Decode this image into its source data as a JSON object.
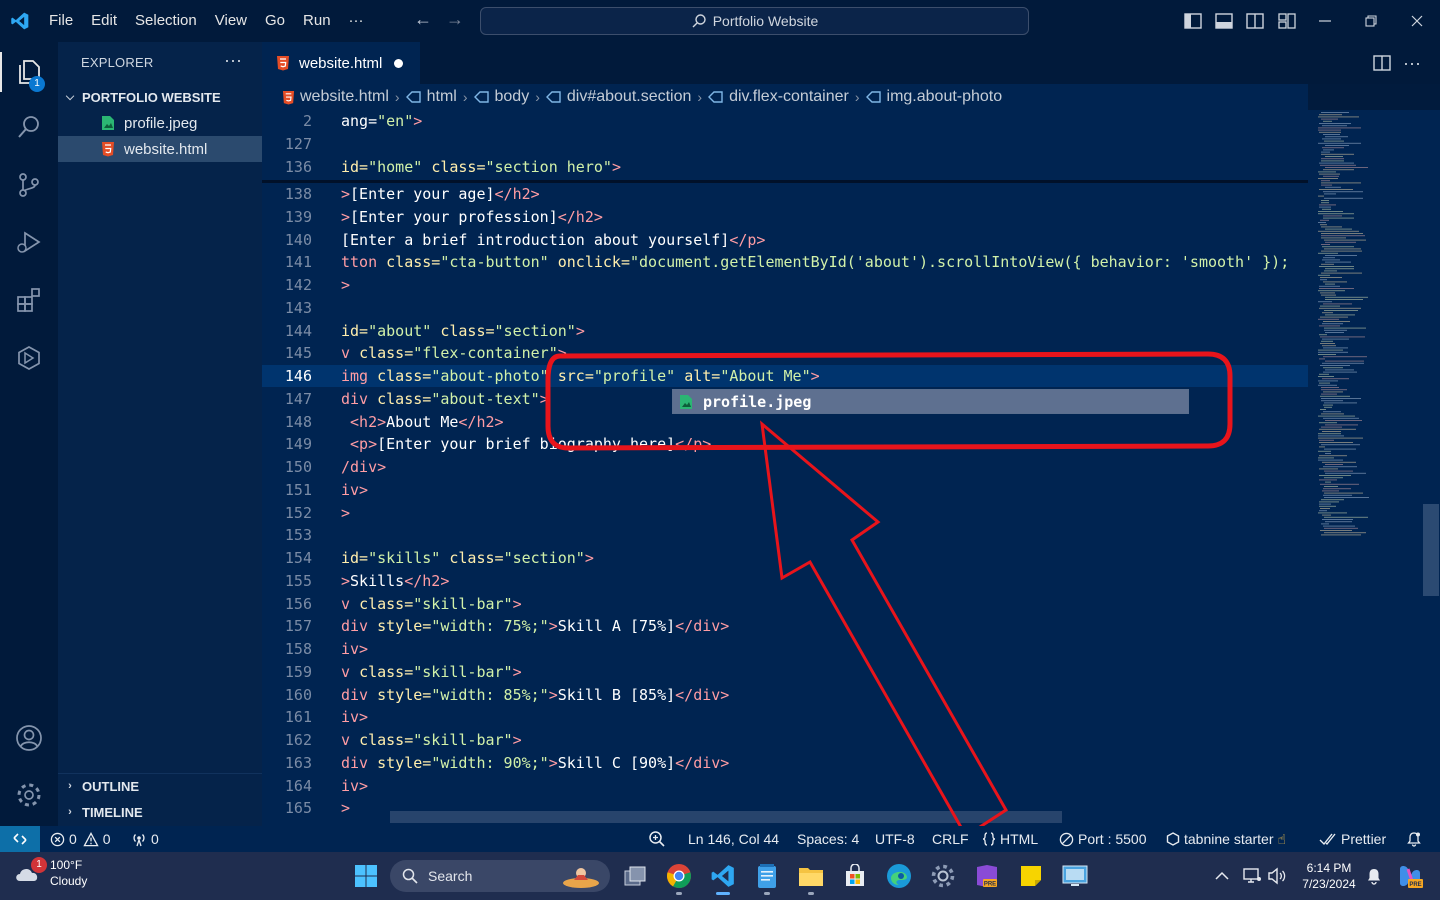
{
  "titlebar": {
    "menu": [
      "File",
      "Edit",
      "Selection",
      "View",
      "Go",
      "Run",
      "···"
    ],
    "search_text": "Portfolio Website"
  },
  "activity": {
    "explorer_badge": "1"
  },
  "sidebar": {
    "title": "EXPLORER",
    "more": "···",
    "folder": "PORTFOLIO WEBSITE",
    "files": [
      {
        "name": "profile.jpeg",
        "type": "image"
      },
      {
        "name": "website.html",
        "type": "html",
        "selected": true
      }
    ],
    "outline": "OUTLINE",
    "timeline": "TIMELINE"
  },
  "tab": {
    "name": "website.html",
    "modified": true
  },
  "breadcrumb": [
    "website.html",
    "html",
    "body",
    "div#about.section",
    "div.flex-container",
    "img.about-photo"
  ],
  "editor": {
    "sticky": [
      {
        "num": "2",
        "tokens": [
          [
            "p",
            "ang="
          ],
          [
            "s",
            "\"en\""
          ],
          [
            "t",
            ">"
          ]
        ]
      },
      {
        "num": "127",
        "tokens": []
      },
      {
        "num": "136",
        "tokens": [
          [
            "a",
            "id="
          ],
          [
            "s",
            "\"home\""
          ],
          [
            "p",
            " "
          ],
          [
            "a",
            "class="
          ],
          [
            "s",
            "\"section hero\""
          ],
          [
            "t",
            ">"
          ]
        ]
      }
    ],
    "lines": [
      {
        "num": "138",
        "tokens": [
          [
            "t",
            ">"
          ],
          [
            "p",
            "[Enter your age]"
          ],
          [
            "t",
            "</h2>"
          ]
        ]
      },
      {
        "num": "139",
        "tokens": [
          [
            "t",
            ">"
          ],
          [
            "p",
            "[Enter your profession]"
          ],
          [
            "t",
            "</h2>"
          ]
        ]
      },
      {
        "num": "140",
        "tokens": [
          [
            "p",
            "[Enter a brief introduction about yourself]"
          ],
          [
            "t",
            "</p>"
          ]
        ]
      },
      {
        "num": "141",
        "tokens": [
          [
            "t",
            "tton "
          ],
          [
            "a",
            "class="
          ],
          [
            "s",
            "\"cta-button\""
          ],
          [
            "p",
            " "
          ],
          [
            "a",
            "onclick="
          ],
          [
            "s",
            "\"document.getElementById('about').scrollIntoView({ behavior: 'smooth' });"
          ]
        ]
      },
      {
        "num": "142",
        "tokens": [
          [
            "t",
            ">"
          ]
        ]
      },
      {
        "num": "143",
        "tokens": []
      },
      {
        "num": "144",
        "tokens": [
          [
            "a",
            "id="
          ],
          [
            "s",
            "\"about\""
          ],
          [
            "p",
            " "
          ],
          [
            "a",
            "class="
          ],
          [
            "s",
            "\"section\""
          ],
          [
            "t",
            ">"
          ]
        ]
      },
      {
        "num": "145",
        "tokens": [
          [
            "t",
            "v "
          ],
          [
            "a",
            "class="
          ],
          [
            "s",
            "\"flex-container\""
          ],
          [
            "t",
            ">"
          ]
        ]
      },
      {
        "num": "146",
        "current": true,
        "tokens": [
          [
            "t",
            "img "
          ],
          [
            "a",
            "class="
          ],
          [
            "s",
            "\"about-photo\""
          ],
          [
            "p",
            " "
          ],
          [
            "a",
            "src="
          ],
          [
            "s",
            "\"profile\""
          ],
          [
            "p",
            " "
          ],
          [
            "a",
            "alt="
          ],
          [
            "s",
            "\"About Me\""
          ],
          [
            "t",
            ">"
          ]
        ]
      },
      {
        "num": "147",
        "tokens": [
          [
            "t",
            "div "
          ],
          [
            "a",
            "class="
          ],
          [
            "s",
            "\"about-text\""
          ],
          [
            "t",
            ">"
          ]
        ]
      },
      {
        "num": "148",
        "tokens": [
          [
            "p",
            " "
          ],
          [
            "t",
            "<h2>"
          ],
          [
            "p",
            "About Me"
          ],
          [
            "t",
            "</h2>"
          ]
        ]
      },
      {
        "num": "149",
        "tokens": [
          [
            "p",
            " "
          ],
          [
            "t",
            "<p>"
          ],
          [
            "p",
            "[Enter your brief biography here]"
          ],
          [
            "t",
            "</p>"
          ]
        ]
      },
      {
        "num": "150",
        "tokens": [
          [
            "t",
            "/div>"
          ]
        ]
      },
      {
        "num": "151",
        "tokens": [
          [
            "t",
            "iv>"
          ]
        ]
      },
      {
        "num": "152",
        "tokens": [
          [
            "t",
            ">"
          ]
        ]
      },
      {
        "num": "153",
        "tokens": []
      },
      {
        "num": "154",
        "tokens": [
          [
            "a",
            "id="
          ],
          [
            "s",
            "\"skills\""
          ],
          [
            "p",
            " "
          ],
          [
            "a",
            "class="
          ],
          [
            "s",
            "\"section\""
          ],
          [
            "t",
            ">"
          ]
        ]
      },
      {
        "num": "155",
        "tokens": [
          [
            "t",
            ">"
          ],
          [
            "p",
            "Skills"
          ],
          [
            "t",
            "</h2>"
          ]
        ]
      },
      {
        "num": "156",
        "tokens": [
          [
            "t",
            "v "
          ],
          [
            "a",
            "class="
          ],
          [
            "s",
            "\"skill-bar\""
          ],
          [
            "t",
            ">"
          ]
        ]
      },
      {
        "num": "157",
        "tokens": [
          [
            "t",
            "div "
          ],
          [
            "a",
            "style="
          ],
          [
            "s",
            "\"width: 75%;\""
          ],
          [
            "t",
            ">"
          ],
          [
            "p",
            "Skill A [75%]"
          ],
          [
            "t",
            "</div>"
          ]
        ]
      },
      {
        "num": "158",
        "tokens": [
          [
            "t",
            "iv>"
          ]
        ]
      },
      {
        "num": "159",
        "tokens": [
          [
            "t",
            "v "
          ],
          [
            "a",
            "class="
          ],
          [
            "s",
            "\"skill-bar\""
          ],
          [
            "t",
            ">"
          ]
        ]
      },
      {
        "num": "160",
        "tokens": [
          [
            "t",
            "div "
          ],
          [
            "a",
            "style="
          ],
          [
            "s",
            "\"width: 85%;\""
          ],
          [
            "t",
            ">"
          ],
          [
            "p",
            "Skill B [85%]"
          ],
          [
            "t",
            "</div>"
          ]
        ]
      },
      {
        "num": "161",
        "tokens": [
          [
            "t",
            "iv>"
          ]
        ]
      },
      {
        "num": "162",
        "tokens": [
          [
            "t",
            "v "
          ],
          [
            "a",
            "class="
          ],
          [
            "s",
            "\"skill-bar\""
          ],
          [
            "t",
            ">"
          ]
        ]
      },
      {
        "num": "163",
        "tokens": [
          [
            "t",
            "div "
          ],
          [
            "a",
            "style="
          ],
          [
            "s",
            "\"width: 90%;\""
          ],
          [
            "t",
            ">"
          ],
          [
            "p",
            "Skill C [90%]"
          ],
          [
            "t",
            "</div>"
          ]
        ]
      },
      {
        "num": "164",
        "tokens": [
          [
            "t",
            "iv>"
          ]
        ]
      },
      {
        "num": "165",
        "tokens": [
          [
            "t",
            ">"
          ]
        ]
      }
    ],
    "suggestion": "profile.jpeg"
  },
  "statusbar": {
    "errors": "0",
    "warnings": "0",
    "ports": "0",
    "position": "Ln 146, Col 44",
    "spaces": "Spaces: 4",
    "encoding": "UTF-8",
    "eol": "CRLF",
    "language": "HTML",
    "port": "Port : 5500",
    "tabnine": "tabnine starter",
    "prettier": "Prettier"
  },
  "taskbar": {
    "weather_temp": "100°F",
    "weather_desc": "Cloudy",
    "weather_badge": "1",
    "search": "Search",
    "time": "6:14 PM",
    "date": "7/23/2024"
  },
  "colors": {
    "editor_bg": "#002451",
    "attr": "#ffeead",
    "string": "#d1f1a9",
    "tag": "#ff9da4",
    "annotation": "#e8141b"
  }
}
